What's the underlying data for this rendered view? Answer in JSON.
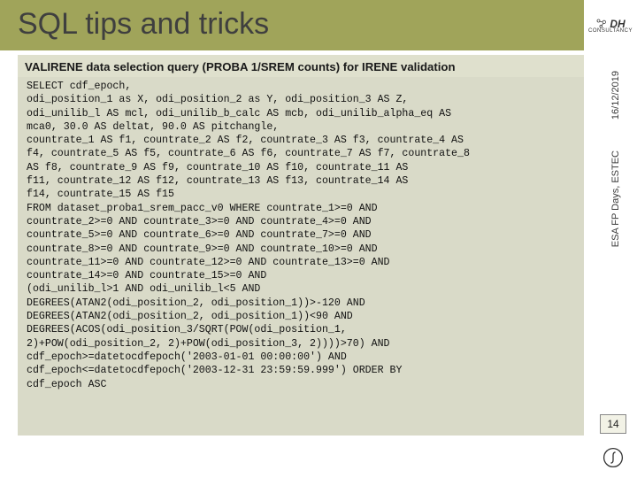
{
  "header": {
    "title": "SQL tips and tricks",
    "logo_letters": "DH",
    "logo_sub": "CONSULTANCY"
  },
  "content": {
    "subtitle": "VALIRENE data selection query (PROBA 1/SREM counts) for IRENE validation",
    "sql": "SELECT cdf_epoch,\nodi_position_1 as X, odi_position_2 as Y, odi_position_3 AS Z,\nodi_unilib_l AS mcl, odi_unilib_b_calc AS mcb, odi_unilib_alpha_eq AS\nmca0, 30.0 AS deltat, 90.0 AS pitchangle,\ncountrate_1 AS f1, countrate_2 AS f2, countrate_3 AS f3, countrate_4 AS\nf4, countrate_5 AS f5, countrate_6 AS f6, countrate_7 AS f7, countrate_8\nAS f8, countrate_9 AS f9, countrate_10 AS f10, countrate_11 AS\nf11, countrate_12 AS f12, countrate_13 AS f13, countrate_14 AS\nf14, countrate_15 AS f15\nFROM dataset_proba1_srem_pacc_v0 WHERE countrate_1>=0 AND\ncountrate_2>=0 AND countrate_3>=0 AND countrate_4>=0 AND\ncountrate_5>=0 AND countrate_6>=0 AND countrate_7>=0 AND\ncountrate_8>=0 AND countrate_9>=0 AND countrate_10>=0 AND\ncountrate_11>=0 AND countrate_12>=0 AND countrate_13>=0 AND\ncountrate_14>=0 AND countrate_15>=0 AND\n(odi_unilib_l>1 AND odi_unilib_l<5 AND\nDEGREES(ATAN2(odi_position_2, odi_position_1))>-120 AND\nDEGREES(ATAN2(odi_position_2, odi_position_1))<90 AND\nDEGREES(ACOS(odi_position_3/SQRT(POW(odi_position_1,\n2)+POW(odi_position_2, 2)+POW(odi_position_3, 2))))>70) AND\ncdf_epoch>=datetocdfepoch('2003-01-01 00:00:00') AND\ncdf_epoch<=datetocdfepoch('2003-12-31 23:59:59.999') ORDER BY\ncdf_epoch ASC"
  },
  "sidebar": {
    "date": "16/12/2019",
    "event": "ESA FP Days, ESTEC"
  },
  "footer": {
    "page_number": "14"
  }
}
